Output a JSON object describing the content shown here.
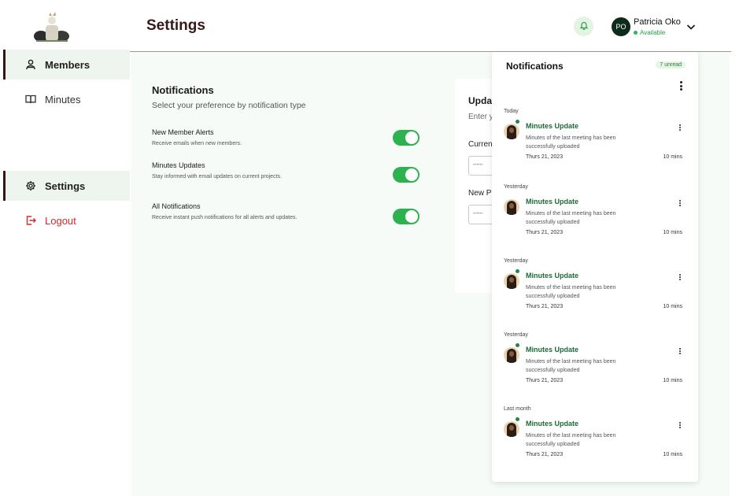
{
  "header": {
    "title": "Settings"
  },
  "user": {
    "initials": "PO",
    "name": "Patricia Oko",
    "status": "Available"
  },
  "sidebar": {
    "items": [
      {
        "label": "Members",
        "icon": "users-icon"
      },
      {
        "label": "Minutes",
        "icon": "book-icon"
      },
      {
        "label": "Settings",
        "icon": "gear-icon"
      },
      {
        "label": "Logout",
        "icon": "logout-icon"
      }
    ]
  },
  "notification_prefs": {
    "title": "Notifications",
    "subtitle": "Select your preference by notification type",
    "items": [
      {
        "title": "New Member Alerts",
        "desc": "Receive emails when new members.",
        "enabled": true
      },
      {
        "title": "Minutes Updates",
        "desc": "Stay informed with email updates on current projects.",
        "enabled": true
      },
      {
        "title": "All Notifications",
        "desc": "Receive instant push notifications for all alerts and updates.",
        "enabled": true
      }
    ]
  },
  "password": {
    "title": "Upda",
    "subtitle": "Enter y",
    "current_label": "Curren",
    "current_value": "••••••",
    "new_label": "New P",
    "new_value": "••••••"
  },
  "notifications_panel": {
    "title": "Notifications",
    "badge": "7 unread",
    "groups": [
      {
        "label": "Today",
        "title": "Minutes Update",
        "body": "Minutes of the last meeting has been successfully uploaded",
        "date": "Thurs 21, 2023",
        "time": "10 mins"
      },
      {
        "label": "Yesterday",
        "title": "Minutes Update",
        "body": "Minutes of the last meeting has been successfully uploaded",
        "date": "Thurs 21, 2023",
        "time": "10 mins"
      },
      {
        "label": "Yesterday",
        "title": "Minutes Update",
        "body": "Minutes of the last meeting has been successfully uploaded",
        "date": "Thurs 21, 2023",
        "time": "10 mins"
      },
      {
        "label": "Yesterday",
        "title": "Minutes Update",
        "body": "Minutes of the last meeting has been successfully uploaded",
        "date": "Thurs 21, 2023",
        "time": "10 mins"
      },
      {
        "label": "Last month",
        "title": "Minutes Update",
        "body": "Minutes of the last meeting has been successfully uploaded",
        "date": "Thurs 21, 2023",
        "time": "10 mins"
      }
    ]
  },
  "colors": {
    "accent": "#2eb24f",
    "brand_dark": "#3a1414",
    "danger": "#d12b2b",
    "active_bg": "#eef5ee"
  }
}
